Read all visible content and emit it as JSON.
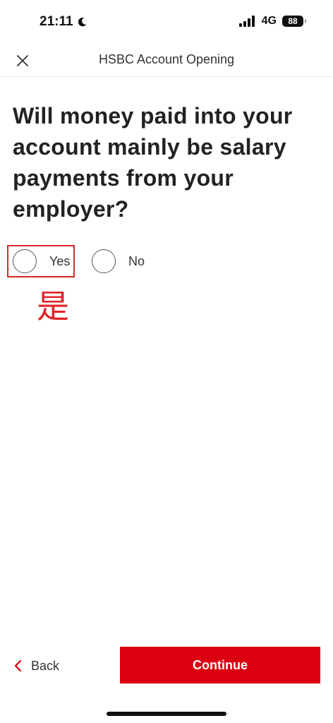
{
  "status_bar": {
    "time": "21:11",
    "network": "4G",
    "battery": "88"
  },
  "header": {
    "title": "HSBC Account Opening"
  },
  "question": {
    "text": "Will money paid into your account mainly be salary payments from your employer?"
  },
  "options": [
    {
      "label": "Yes",
      "selected": false
    },
    {
      "label": "No",
      "selected": false
    }
  ],
  "annotation": {
    "text": "是",
    "color": "#e0242a"
  },
  "footer": {
    "back_label": "Back",
    "continue_label": "Continue"
  },
  "colors": {
    "brand_red": "#db0011",
    "highlight_box": "#d62a2a"
  },
  "icons": {
    "close": "close-icon",
    "back": "chevron-left-icon",
    "moon": "moon-icon",
    "signal": "signal-icon"
  }
}
